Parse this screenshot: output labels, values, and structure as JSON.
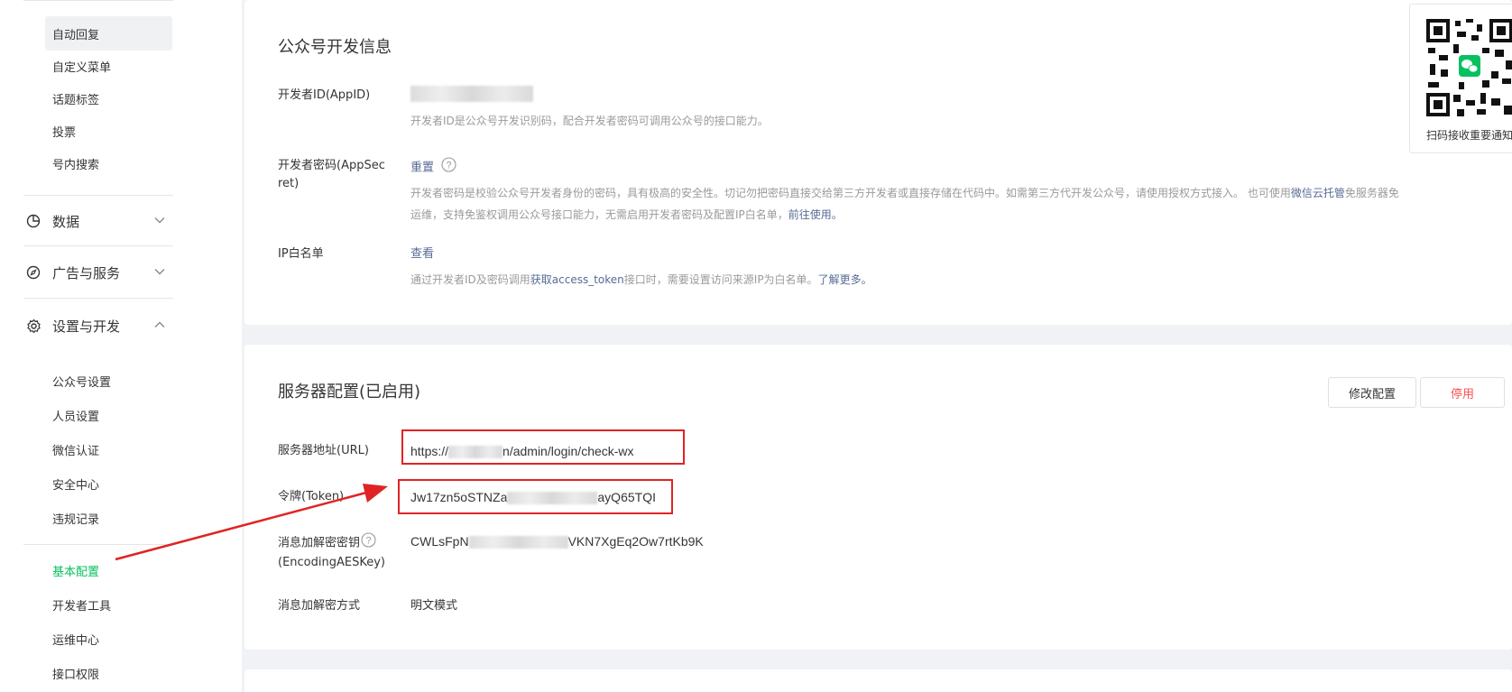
{
  "sidebar": {
    "top_items": [
      "自动回复",
      "自定义菜单",
      "话题标签",
      "投票",
      "号内搜索"
    ],
    "groups": [
      {
        "label": "数据",
        "icon": "pie-chart-icon",
        "expanded": false
      },
      {
        "label": "广告与服务",
        "icon": "compass-icon",
        "expanded": false
      },
      {
        "label": "设置与开发",
        "icon": "gear-icon",
        "expanded": true
      }
    ],
    "settings_items": [
      "公众号设置",
      "人员设置",
      "微信认证",
      "安全中心",
      "违规记录"
    ],
    "dev_items": [
      "基本配置",
      "开发者工具",
      "运维中心",
      "接口权限"
    ],
    "active_item": "基本配置",
    "active_color": "#07c160"
  },
  "dev_info": {
    "title": "公众号开发信息",
    "appid": {
      "label": "开发者ID(AppID)",
      "desc": "开发者ID是公众号开发识别码，配合开发者密码可调用公众号的接口能力。"
    },
    "appsecret": {
      "label_line1": "开发者密码(AppSec",
      "label_line2": "ret)",
      "reset_link": "重置",
      "desc_part1": "开发者密码是校验公众号开发者身份的密码，具有极高的安全性。切记勿把密码直接交给第三方开发者或直接存储在代码中。如需第三方代开发公众号，请使用授权方式接入。 也可使用",
      "desc_link1": "微信云托管",
      "desc_part2": "免服务器免",
      "desc_part3": "运维，支持免鉴权调用公众号接口能力，无需启用开发者密码及配置IP白名单，",
      "desc_link2": "前往使用。"
    },
    "ip_whitelist": {
      "label": "IP白名单",
      "view_link": "查看",
      "desc_part1": "通过开发者ID及密码调用",
      "desc_link1": "获取access_token",
      "desc_part2": "接口时，需要设置访问来源IP为白名单。",
      "desc_link2": "了解更多。"
    }
  },
  "server_config": {
    "title": "服务器配置(已启用)",
    "modify_button": "修改配置",
    "disable_button": "停用",
    "url": {
      "label": "服务器地址(URL)",
      "prefix": "https://",
      "suffix": "n/admin/login/check-wx"
    },
    "token": {
      "label": "令牌(Token)",
      "prefix": "Jw17zn5oSTNZa",
      "suffix": "ayQ65TQI"
    },
    "aes_key": {
      "label_line1": "消息加解密密钥",
      "label_line2": "(EncodingAESKey)",
      "prefix": "CWLsFpN",
      "suffix": "VKN7XgEq2Ow7rtKb9K"
    },
    "encrypt_mode": {
      "label": "消息加解密方式",
      "value": "明文模式"
    }
  },
  "qr_panel": {
    "caption": "扫码接收重要通知"
  },
  "colors": {
    "link": "#576b95",
    "annotation_red": "#e02424",
    "danger": "#fa5151"
  }
}
